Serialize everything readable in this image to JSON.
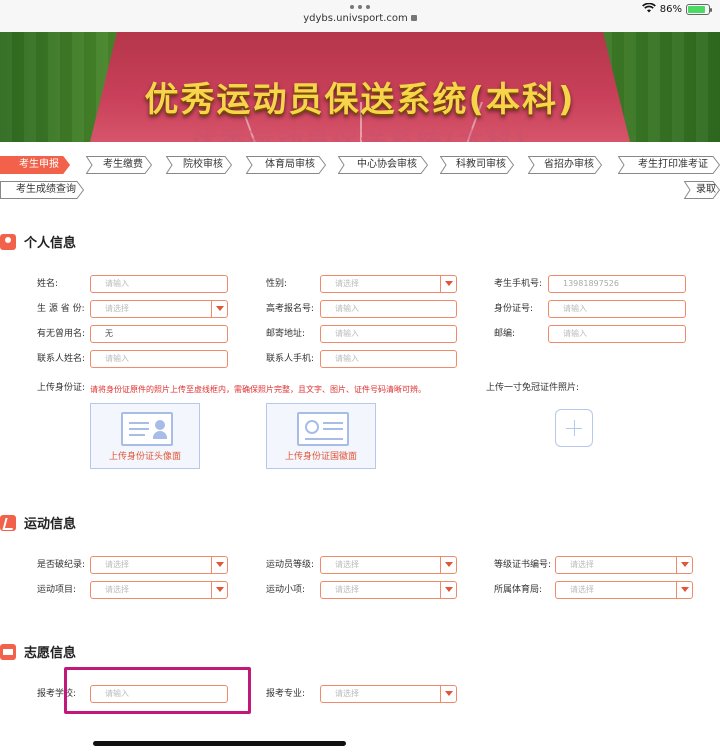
{
  "browser": {
    "url": "ydybs.univsport.com",
    "battery": "86%",
    "battery_level": 0.86
  },
  "banner": {
    "title": "优秀运动员保送系统(本科)"
  },
  "steps": [
    "考生申报",
    "考生缴费",
    "院校审核",
    "体育局审核",
    "中心协会审核",
    "科教司审核",
    "省招办审核",
    "考生打印准考证",
    "考生成绩查询",
    "录取"
  ],
  "active_step": "考生申报",
  "personal": {
    "title": "个人信息",
    "name_label": "姓名:",
    "name_placeholder": "请输入",
    "gender_label": "性别:",
    "gender_value": "请选择",
    "phone_label": "考生手机号:",
    "phone_value": "13981897526",
    "province_label": "生 源 省 份:",
    "province_value": "请选择",
    "exam_no_label": "高考报名号:",
    "exam_no_placeholder": "请输入",
    "idcard_label": "身份证号:",
    "idcard_placeholder": "请输入",
    "former_name_label": "有无曾用名:",
    "former_name_value": "无",
    "address_label": "邮寄地址:",
    "address_placeholder": "请输入",
    "zip_label": "邮编:",
    "zip_placeholder": "请输入",
    "contact_name_label": "联系人姓名:",
    "contact_name_placeholder": "请输入",
    "contact_phone_label": "联系人手机:",
    "contact_phone_placeholder": "请输入",
    "upload_id_label": "上传身份证:",
    "upload_notice": "请将身份证原件的照片上传至虚线框内，需确保照片完整，且文字、图片、证件号码清晰可辨。",
    "upload_front_caption": "上传身份证头像面",
    "upload_back_caption": "上传身份证国徽面",
    "upload_photo_label": "上传一寸免冠证件照片:"
  },
  "sports": {
    "title": "运动信息",
    "record_label": "是否破纪录:",
    "record_value": "请选择",
    "level_label": "运动员等级:",
    "level_value": "请选择",
    "cert_label": "等级证书编号:",
    "cert_value": "请选择",
    "event_label": "运动项目:",
    "event_value": "请选择",
    "sub_event_label": "运动小项:",
    "sub_event_value": "请选择",
    "bureau_label": "所属体育局:",
    "bureau_value": "请选择"
  },
  "wish": {
    "title": "志愿信息",
    "school_label": "报考学校:",
    "school_placeholder": "请输入",
    "major_label": "报考专业:",
    "major_value": "请选择"
  },
  "colors": {
    "accent": "#f2624a",
    "field_border": "#f08a6a",
    "notice": "#e03030",
    "highlight": "#c2187a"
  }
}
